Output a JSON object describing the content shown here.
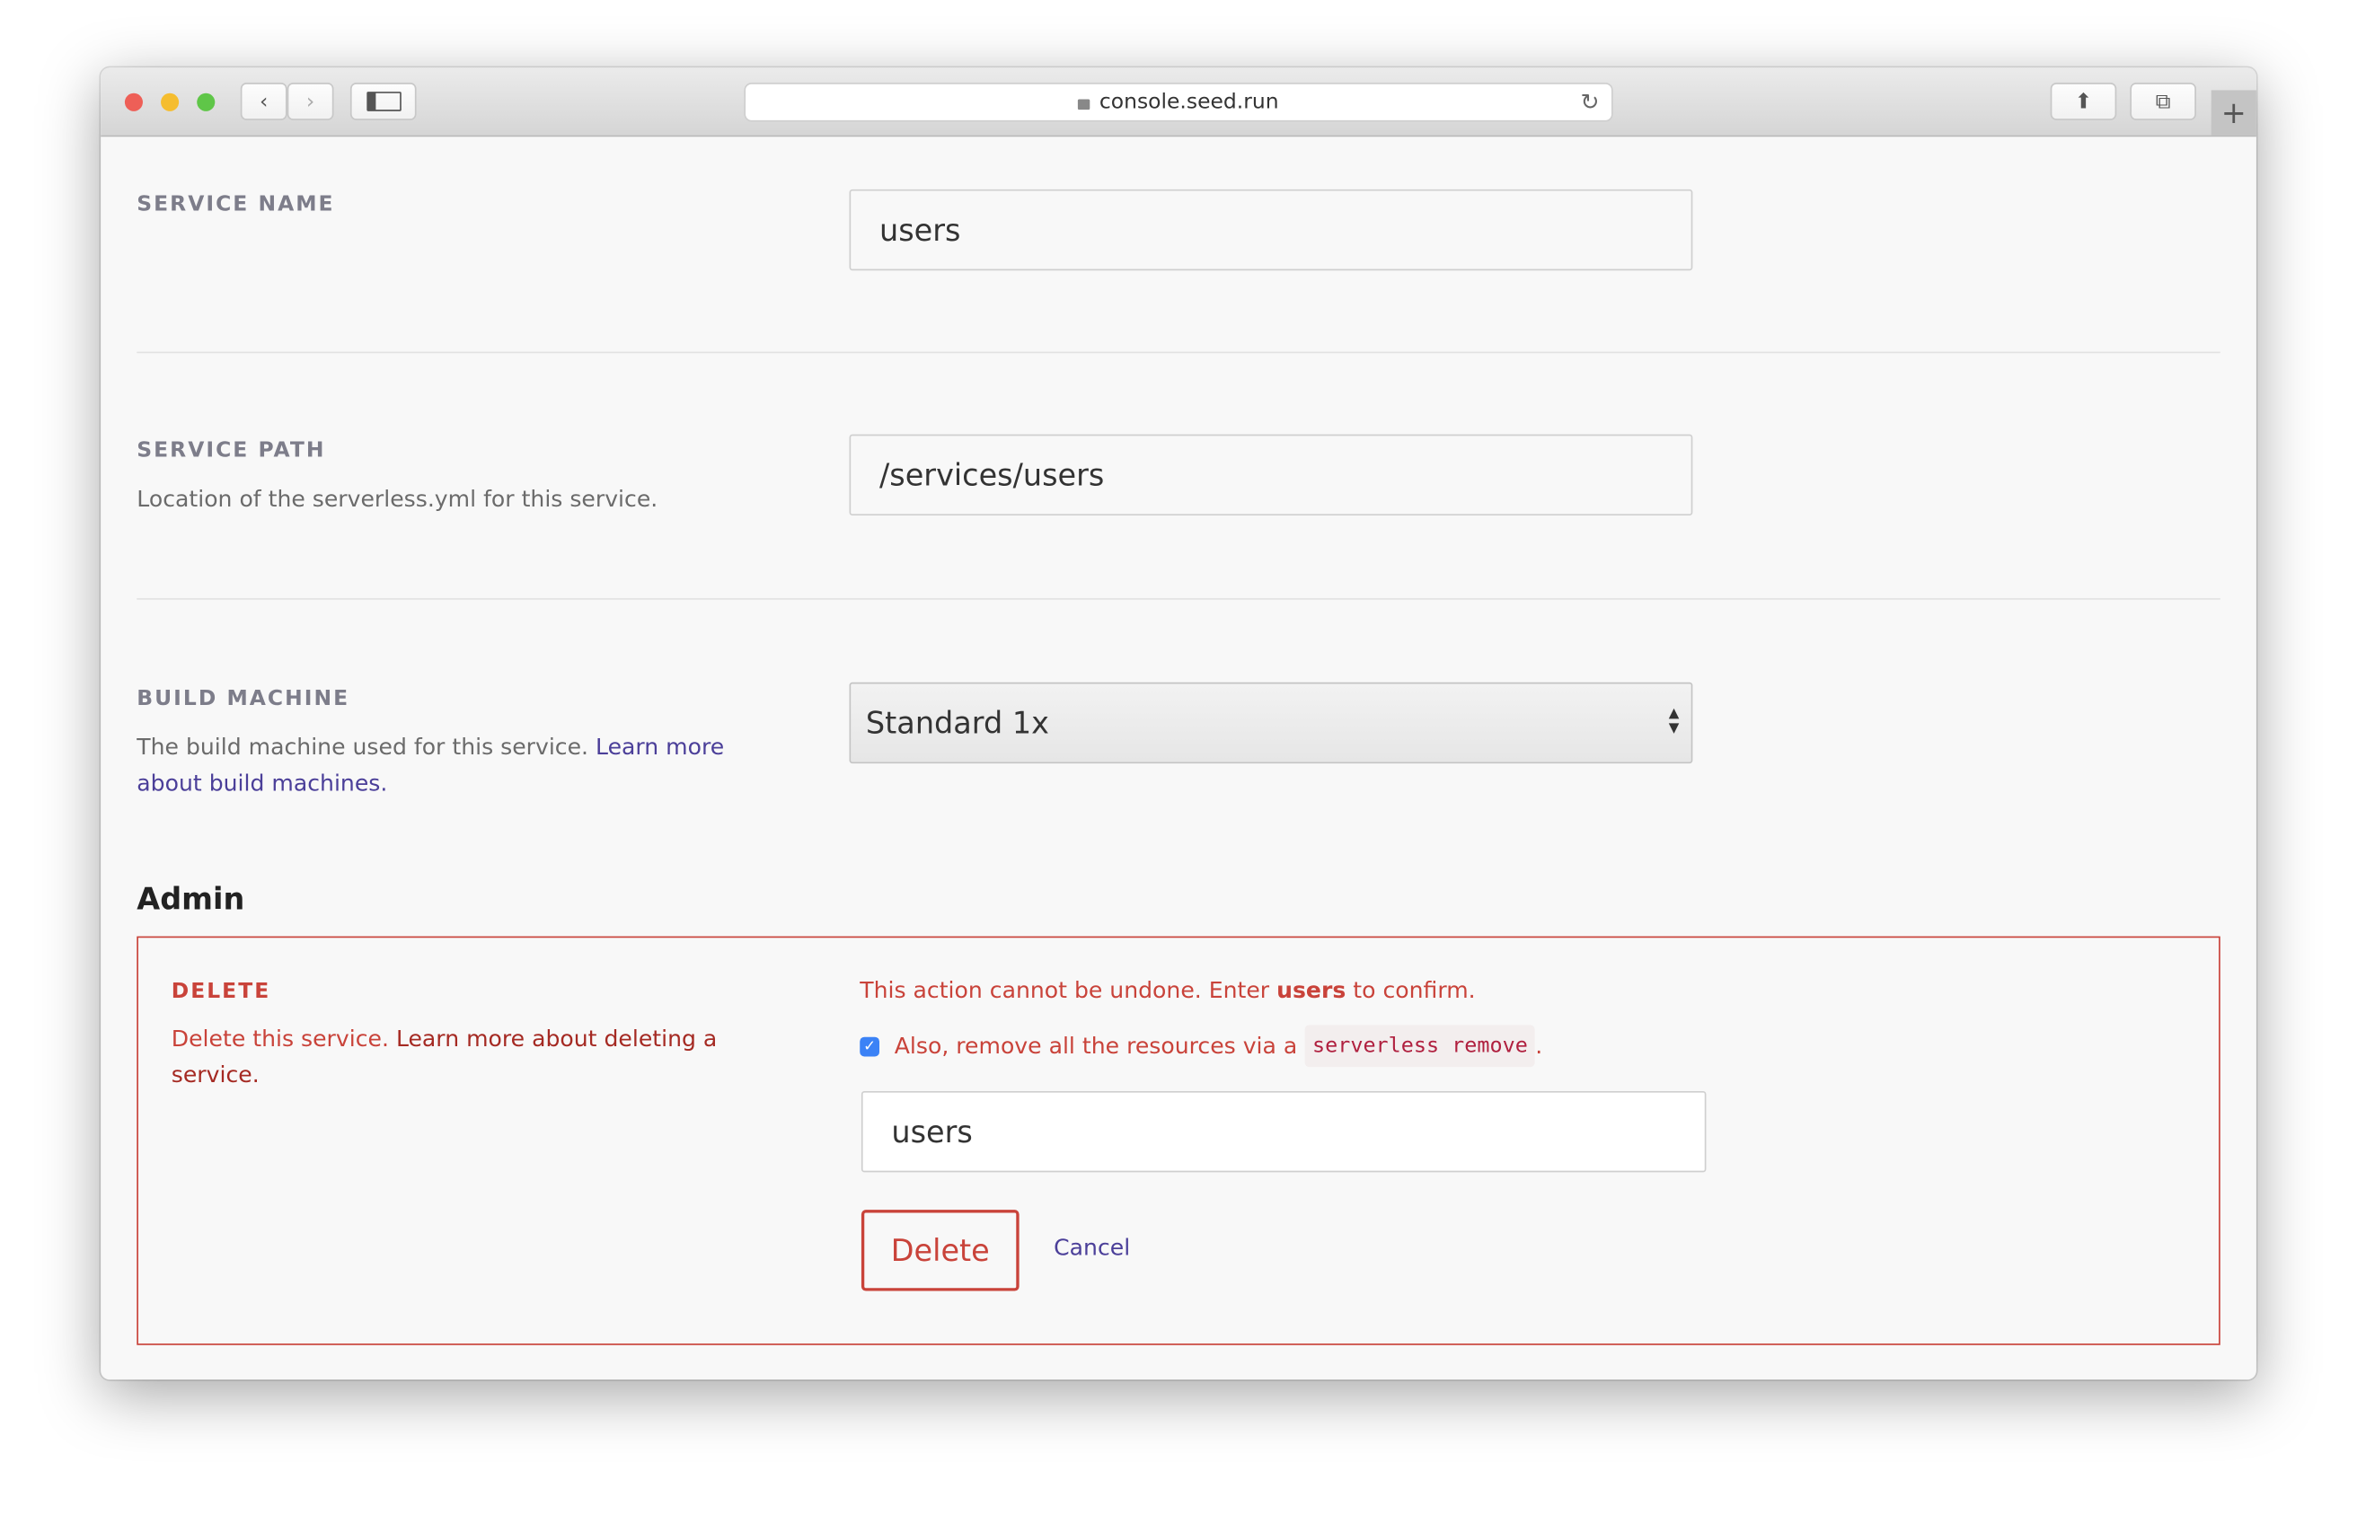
{
  "browser": {
    "url": "console.seed.run",
    "colors": {
      "close": "#ee5f57",
      "minimize": "#f5bd2f",
      "zoom": "#5fc648"
    }
  },
  "service_name": {
    "label": "SERVICE NAME",
    "value": "users"
  },
  "service_path": {
    "label": "SERVICE PATH",
    "description": "Location of the serverless.yml for this service.",
    "value": "/services/users"
  },
  "build_machine": {
    "label": "BUILD MACHINE",
    "description": "The build machine used for this service.",
    "link": "Learn more about build machines.",
    "selected": "Standard 1x"
  },
  "admin": {
    "heading": "Admin",
    "delete_label": "DELETE",
    "delete_description": "Delete this service.",
    "delete_link": "Learn more about deleting a service.",
    "warning_prefix": "This action cannot be undone. Enter",
    "warning_name": "users",
    "warning_suffix": "to confirm.",
    "checkbox_checked": true,
    "checkbox_label": "Also, remove all the resources via a",
    "checkbox_code": "serverless remove",
    "checkbox_end": ".",
    "confirm_value": "users",
    "delete_button": "Delete",
    "cancel_button": "Cancel",
    "accent": "#c9433a"
  }
}
